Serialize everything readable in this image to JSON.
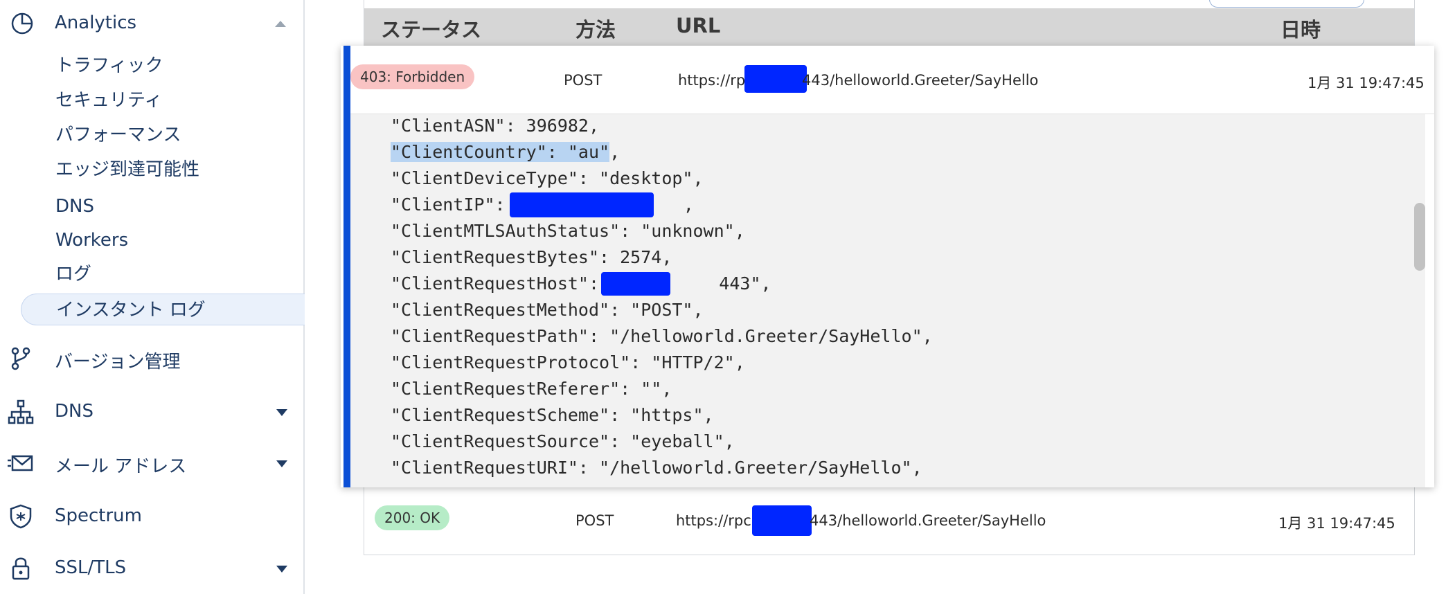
{
  "sidebar": {
    "analytics": {
      "label": "Analytics"
    },
    "subitems": [
      "トラフィック",
      "セキュリティ",
      "パフォーマンス",
      "エッジ到達可能性",
      "DNS",
      "Workers",
      "ログ",
      "インスタント ログ"
    ],
    "main": [
      {
        "label": "バージョン管理",
        "icon": "branch-icon",
        "caret": false
      },
      {
        "label": "DNS",
        "icon": "network-tree-icon",
        "caret": true
      },
      {
        "label": "メール アドレス",
        "icon": "mail-icon",
        "caret": true
      },
      {
        "label": "Spectrum",
        "icon": "shield-icon",
        "caret": false
      },
      {
        "label": "SSL/TLS",
        "icon": "lock-icon",
        "caret": true
      }
    ]
  },
  "table": {
    "headers": {
      "status": "ステータス",
      "method": "方法",
      "url": "URL",
      "datetime": "日時"
    },
    "rows": [
      {
        "status": "403: Forbidden",
        "method": "POST",
        "url_prefix": "https://rpc",
        "url_suffix": "443/helloworld.Greeter/SayHello",
        "datetime": "1月 31 19:47:45"
      },
      {
        "status": "200: OK",
        "method": "POST",
        "url_prefix": "https://rpc",
        "url_suffix": "443/helloworld.Greeter/SayHello",
        "datetime": "1月 31 19:47:45"
      }
    ]
  },
  "json_lines": [
    "\"ClientASN\": 396982,",
    "\"ClientCountry\": \"au\",",
    "\"ClientDeviceType\": \"desktop\",",
    "\"ClientIP\": \"3",
    "\"ClientMTLSAuthStatus\": \"unknown\",",
    "\"ClientRequestBytes\": 2574,",
    "\"ClientRequestHost\": \"rpc",
    "\"ClientRequestMethod\": \"POST\",",
    "\"ClientRequestPath\": \"/helloworld.Greeter/SayHello\",",
    "\"ClientRequestProtocol\": \"HTTP/2\",",
    "\"ClientRequestReferer\": \"\",",
    "\"ClientRequestScheme\": \"https\",",
    "\"ClientRequestSource\": \"eyeball\",",
    "\"ClientRequestURI\": \"/helloworld.Greeter/SayHello\","
  ],
  "json_fragments": {
    "country_highlight": "\"ClientCountry\": \"au\"",
    "country_tail": ",",
    "ip_tail": ",",
    "host_tail": "443\","
  },
  "colors": {
    "accent": "#0b4fd6",
    "redaction": "#0026ff",
    "error_badge": "#f9c3c3",
    "ok_badge": "#b6ecc7",
    "highlight": "#b8d4f2"
  }
}
